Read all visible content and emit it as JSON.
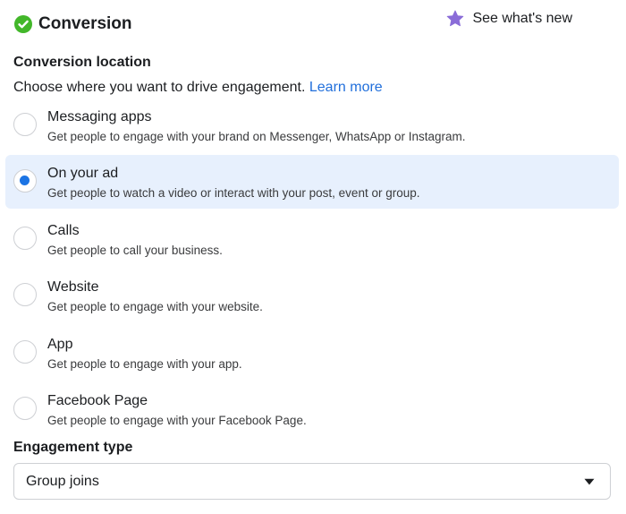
{
  "header": {
    "title": "Conversion",
    "whats_new_label": "See what's new"
  },
  "conversion_location": {
    "title": "Conversion location",
    "description": "Choose where you want to drive engagement.",
    "learn_more": "Learn more",
    "selected": "On your ad",
    "options": [
      {
        "label": "Messaging apps",
        "description": "Get people to engage with your brand on Messenger, WhatsApp or Instagram."
      },
      {
        "label": "On your ad",
        "description": "Get people to watch a video or interact with your post, event or group."
      },
      {
        "label": "Calls",
        "description": "Get people to call your business."
      },
      {
        "label": "Website",
        "description": "Get people to engage with your website."
      },
      {
        "label": "App",
        "description": "Get people to engage with your app."
      },
      {
        "label": "Facebook Page",
        "description": "Get people to engage with your Facebook Page."
      }
    ]
  },
  "engagement_type": {
    "title": "Engagement type",
    "value": "Group joins"
  },
  "colors": {
    "check_green": "#42b72a",
    "accent_blue": "#1b74e4",
    "link_blue": "#216fdb",
    "selected_bg": "#e7f0fd",
    "star_purple": "#8a6cd8"
  },
  "icons": {
    "header_status": "check-circle-icon",
    "whats_new": "star-icon",
    "dropdown": "caret-down-icon"
  }
}
